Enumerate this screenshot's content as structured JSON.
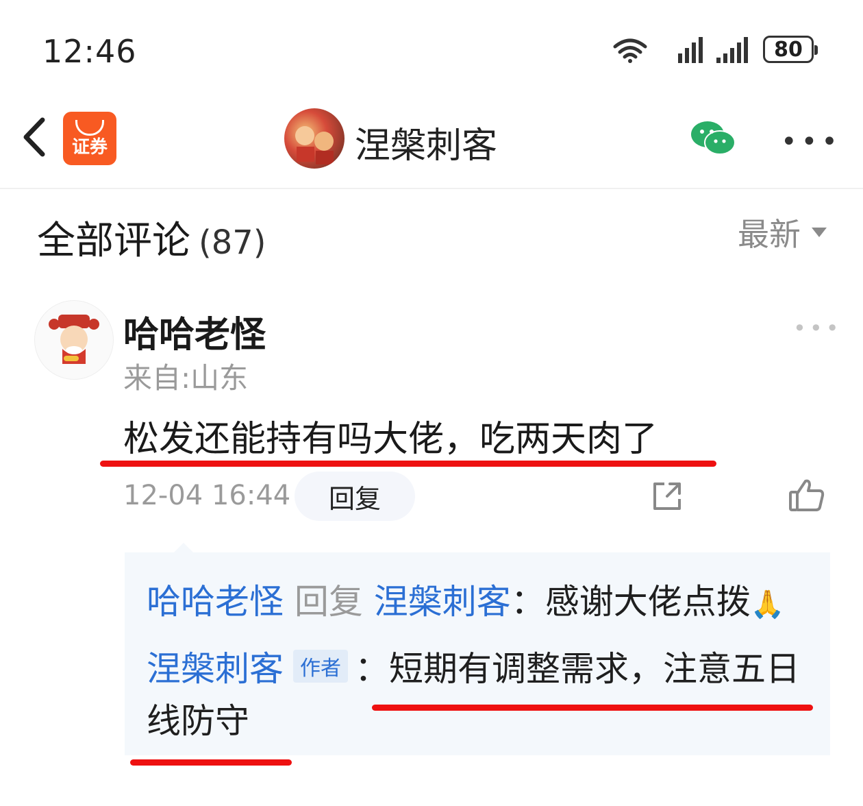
{
  "status_bar": {
    "time": "12:46",
    "network_wifi": "6+",
    "network_cell": "4G",
    "battery": "80"
  },
  "header": {
    "app_badge": "证券",
    "title": "涅槃刺客"
  },
  "comments_header": {
    "title": "全部评论",
    "count": "(87)",
    "sort_label": "最新"
  },
  "comment": {
    "username": "哈哈老怪",
    "location": "来自:山东",
    "text": "松发还能持有吗大佬，吃两天肉了",
    "timestamp": "12-04 16:44",
    "reply_label": "回复"
  },
  "replies": [
    {
      "from": "哈哈老怪",
      "verb": "回复",
      "to": "涅槃刺客",
      "sep": "：",
      "text": "感谢大佬点拨",
      "emoji": "🙏"
    },
    {
      "from": "涅槃刺客",
      "tag": "作者",
      "sep": "：",
      "text_line1": "短期有调整需求，注意五日",
      "text_line2": "线防守"
    }
  ],
  "colors": {
    "accent_blue": "#2b6fd4",
    "annotation_red": "#ee1111",
    "app_orange": "#f85a22",
    "wechat_green": "#2aae67"
  }
}
